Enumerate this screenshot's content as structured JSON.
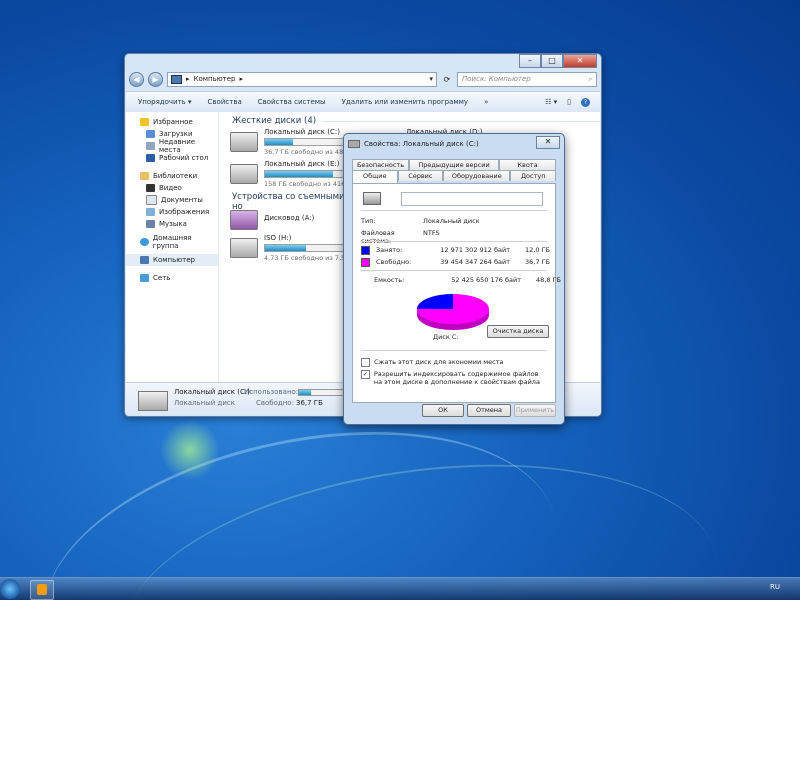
{
  "explorer": {
    "address": "Компьютер",
    "search_placeholder": "Поиск: Компьютер",
    "toolbar": {
      "organize": "Упорядочить",
      "properties": "Свойства",
      "system_properties": "Свойства системы",
      "uninstall": "Удалить или изменить программу",
      "more": "»"
    },
    "nav": {
      "favorites": "Избранное",
      "downloads": "Загрузки",
      "recent": "Недавние места",
      "desktop": "Рабочий стол",
      "libraries": "Библиотеки",
      "video": "Видео",
      "documents": "Документы",
      "images": "Изображения",
      "music": "Музыка",
      "homegroup": "Домашняя группа",
      "computer": "Компьютер",
      "network": "Сеть"
    },
    "group_hdd": "Жесткие диски (4)",
    "group_removable": "Устройства со съемными но",
    "drives": [
      {
        "name": "Локальный диск (C:)",
        "free": "36,7 ГБ свободно из 48,8 ГБ",
        "used_fraction": 0.25
      },
      {
        "name": "Локальный диск (E:)",
        "free": "158 ГБ свободно из 416 ГБ",
        "used_fraction": 0.62
      },
      {
        "name": "Локальный диск (D:)"
      }
    ],
    "removable": [
      {
        "name": "Дисковод (A:)"
      },
      {
        "name": "ISO (H:)",
        "free": "4,73 ГБ свободно из 7,52 ГБ",
        "used_fraction": 0.37
      }
    ],
    "details": {
      "name": "Локальный диск (C:)",
      "type": "Локальный диск",
      "used_label": "Использовано:",
      "free_label": "Свободно:",
      "free_value": "36,7 ГБ",
      "used_fraction": 0.25
    }
  },
  "dialog": {
    "title": "Свойства: Локальный диск (C:)",
    "tabs_row1": [
      "Безопасность",
      "Предыдущие версии",
      "Квота"
    ],
    "tabs_row2": [
      "Общие",
      "Сервис",
      "Оборудование",
      "Доступ"
    ],
    "type_label": "Тип:",
    "type_value": "Локальный диск",
    "fs_label": "Файловая система:",
    "fs_value": "NTFS",
    "used_label": "Занято:",
    "used_bytes": "12 971 302 912 байт",
    "used_gb": "12,0 ГБ",
    "free_label": "Свободно:",
    "free_bytes": "39 454 347 264 байт",
    "free_gb": "36,7 ГБ",
    "capacity_label": "Емкость:",
    "capacity_bytes": "52 425 650 176 байт",
    "capacity_gb": "48,8 ГБ",
    "disk_label": "Диск C:",
    "cleanup": "Очистка диска",
    "compress": "Сжать этот диск для экономии места",
    "index": "Разрешить индексировать содержимое файлов на этом диске в дополнение к свойствам файла",
    "ok": "ОК",
    "cancel": "Отмена",
    "apply": "Применить",
    "used_color": "#0000ff",
    "free_color": "#ff00ff",
    "used_fraction": 0.247
  },
  "taskbar": {
    "lang": "RU"
  }
}
